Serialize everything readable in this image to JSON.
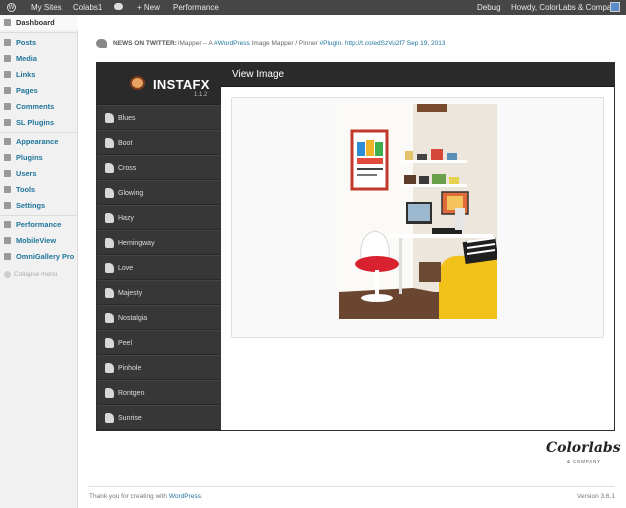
{
  "adminbar": {
    "wp_logo_icon": "wordpress-logo-icon",
    "my_sites": "My Sites",
    "site_name": "Colabs1",
    "comments_icon": "comment-bubble-icon",
    "new_label": "+ New",
    "performance": "Performance",
    "debug": "Debug",
    "howdy": "Howdy, ColorLabs & Company"
  },
  "sidebar": {
    "items": [
      {
        "label": "Dashboard",
        "icon": "dashboard-icon"
      },
      {
        "label": "Posts",
        "icon": "pushpin-icon"
      },
      {
        "label": "Media",
        "icon": "media-icon"
      },
      {
        "label": "Links",
        "icon": "link-icon"
      },
      {
        "label": "Pages",
        "icon": "page-icon"
      },
      {
        "label": "Comments",
        "icon": "comments-icon"
      },
      {
        "label": "SL Plugins",
        "icon": "sl-plugins-icon"
      },
      {
        "label": "Appearance",
        "icon": "appearance-icon"
      },
      {
        "label": "Plugins",
        "icon": "plugins-icon"
      },
      {
        "label": "Users",
        "icon": "users-icon"
      },
      {
        "label": "Tools",
        "icon": "tools-icon"
      },
      {
        "label": "Settings",
        "icon": "settings-icon"
      },
      {
        "label": "Performance",
        "icon": "performance-icon"
      },
      {
        "label": "MobileView",
        "icon": "mobileview-icon"
      },
      {
        "label": "OmniGallery Pro",
        "icon": "omnigallery-icon"
      }
    ],
    "collapse_label": "Collapse menu"
  },
  "twitter": {
    "label": "NEWS ON TWITTER:",
    "text_prefix": "iMapper – A ",
    "hashtag1": "#WordPress",
    "text_middle": " Image Mapper / Pinner ",
    "hashtag2": "#Plugin",
    "text_sep": ". ",
    "link": "http://t.co/edSzVu2f7",
    "date": "Sep 19, 2013"
  },
  "plugin": {
    "logo_text": "INSTAFX",
    "version": "1.1.2",
    "header_title": "View Image",
    "filters": [
      "Blues",
      "Boot",
      "Cross",
      "Glowing",
      "Hazy",
      "Hemingway",
      "Love",
      "Majesty",
      "Nostalgia",
      "Peel",
      "Pinhole",
      "Rontgen",
      "Sunrise"
    ]
  },
  "branding": {
    "logo": "Colorlabs",
    "sub": "& COMPANY"
  },
  "footer": {
    "thanks_prefix": "Thank you for creating with ",
    "wordpress_link": "WordPress",
    "thanks_suffix": ".",
    "version": "Version 3.6.1"
  }
}
